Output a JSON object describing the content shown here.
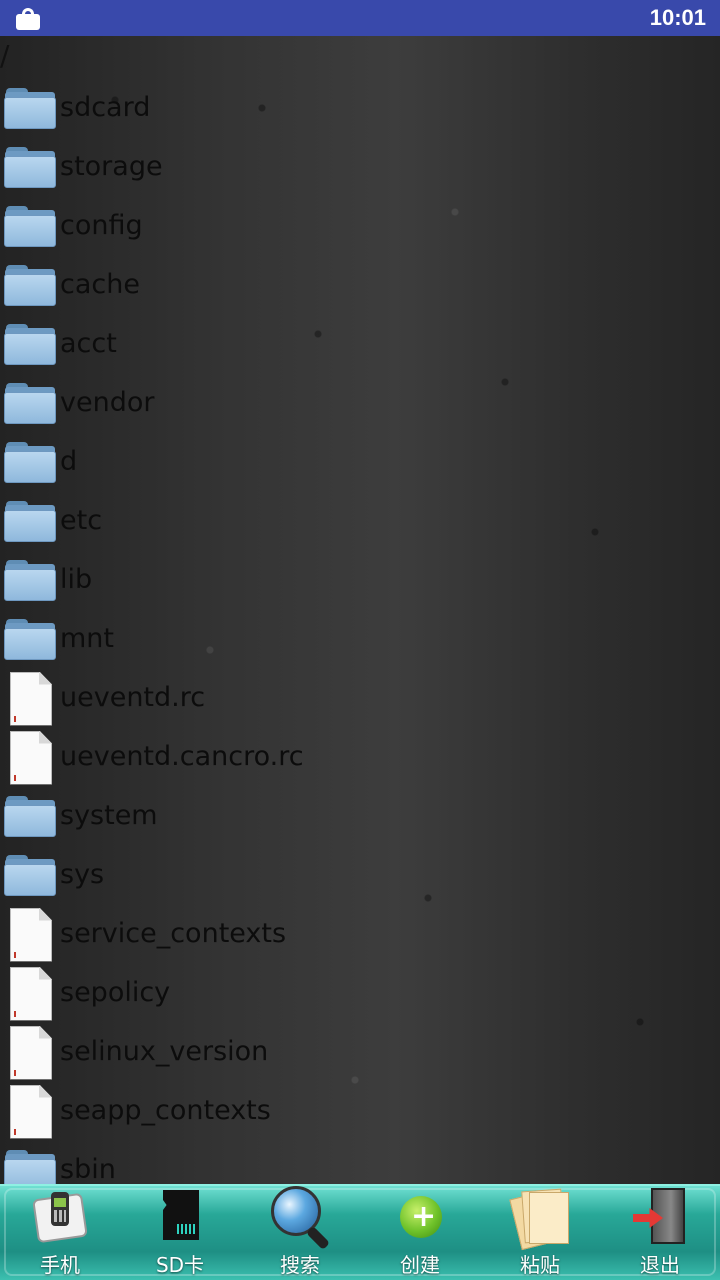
{
  "status_bar": {
    "time": "10:01",
    "icons": [
      "shopping-bag-icon"
    ],
    "background": "#3949ab"
  },
  "browser": {
    "path": "/",
    "entries": [
      {
        "name": "sdcard",
        "type": "folder"
      },
      {
        "name": "storage",
        "type": "folder"
      },
      {
        "name": "config",
        "type": "folder"
      },
      {
        "name": "cache",
        "type": "folder"
      },
      {
        "name": "acct",
        "type": "folder"
      },
      {
        "name": "vendor",
        "type": "folder"
      },
      {
        "name": "d",
        "type": "folder"
      },
      {
        "name": "etc",
        "type": "folder"
      },
      {
        "name": "lib",
        "type": "folder"
      },
      {
        "name": "mnt",
        "type": "folder"
      },
      {
        "name": "ueventd.rc",
        "type": "file"
      },
      {
        "name": "ueventd.cancro.rc",
        "type": "file"
      },
      {
        "name": "system",
        "type": "folder"
      },
      {
        "name": "sys",
        "type": "folder"
      },
      {
        "name": "service_contexts",
        "type": "file"
      },
      {
        "name": "sepolicy",
        "type": "file"
      },
      {
        "name": "selinux_version",
        "type": "file"
      },
      {
        "name": "seapp_contexts",
        "type": "file"
      },
      {
        "name": "sbin",
        "type": "folder"
      }
    ]
  },
  "toolbar": {
    "items": [
      {
        "label": "手机",
        "icon": "phone-icon"
      },
      {
        "label": "SD卡",
        "icon": "sd-card-icon"
      },
      {
        "label": "搜索",
        "icon": "search-icon"
      },
      {
        "label": "创建",
        "icon": "create-icon"
      },
      {
        "label": "粘贴",
        "icon": "paste-icon"
      },
      {
        "label": "退出",
        "icon": "exit-icon"
      }
    ],
    "accent": "#2bb3a3"
  }
}
